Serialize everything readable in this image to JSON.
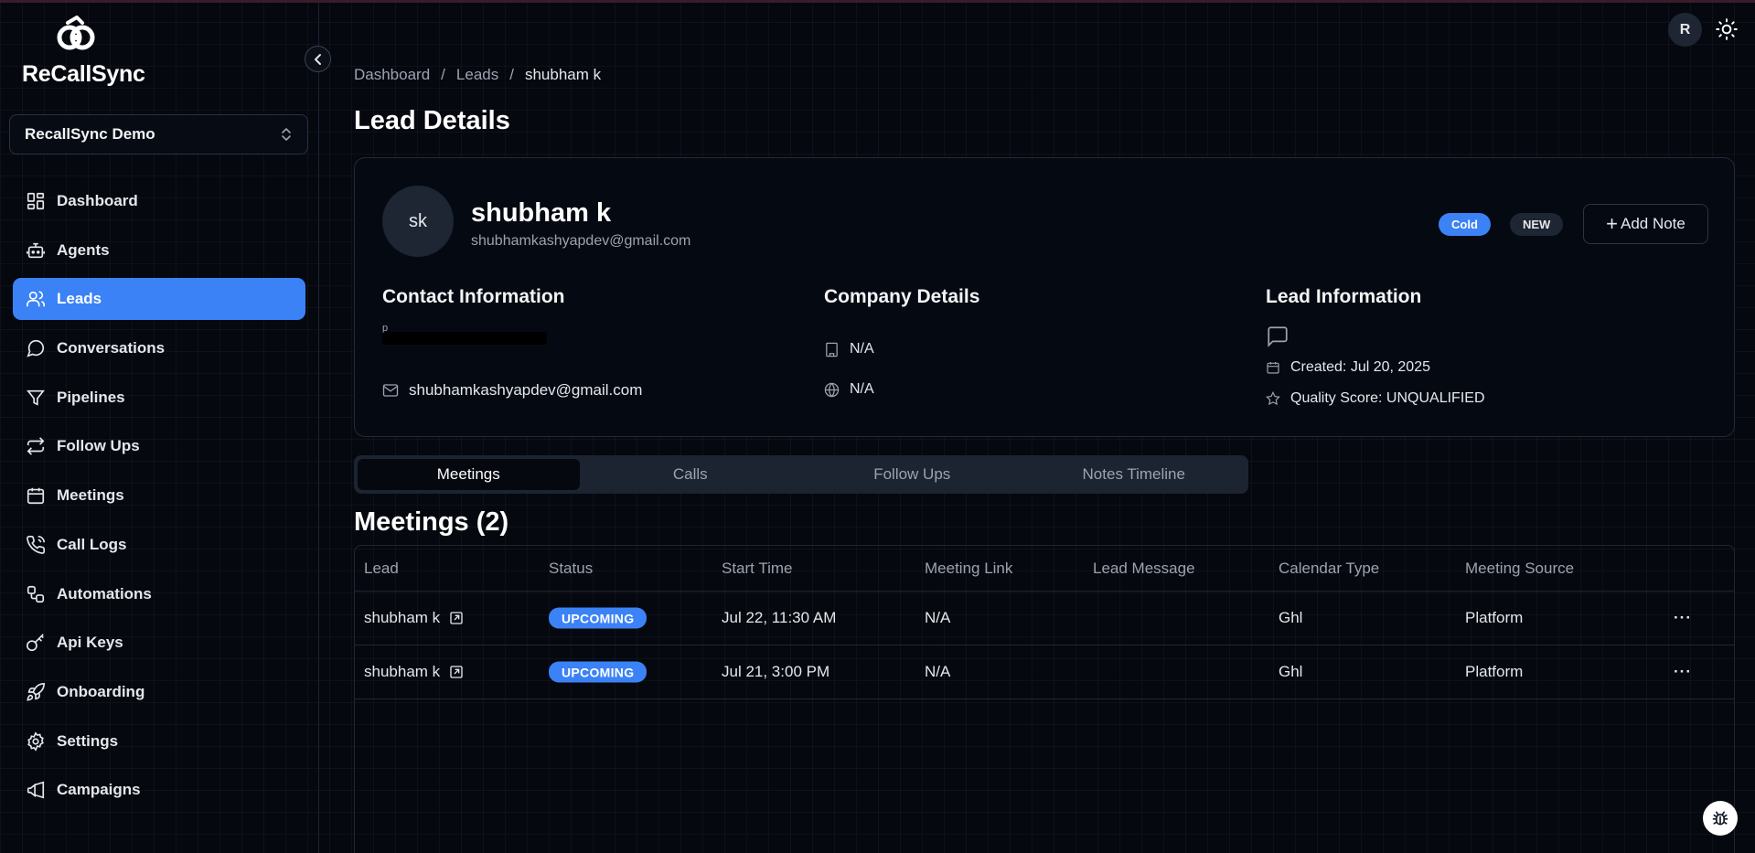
{
  "app": {
    "name": "ReCallSync"
  },
  "workspace": {
    "label": "RecallSync Demo"
  },
  "sidebar": {
    "items": [
      {
        "label": "Dashboard",
        "icon": "dashboard-icon"
      },
      {
        "label": "Agents",
        "icon": "bot-icon"
      },
      {
        "label": "Leads",
        "icon": "users-icon",
        "active": true
      },
      {
        "label": "Conversations",
        "icon": "message-circle-icon"
      },
      {
        "label": "Pipelines",
        "icon": "filter-icon"
      },
      {
        "label": "Follow Ups",
        "icon": "repeat-icon"
      },
      {
        "label": "Meetings",
        "icon": "calendar-icon"
      },
      {
        "label": "Call Logs",
        "icon": "phone-call-icon"
      },
      {
        "label": "Automations",
        "icon": "workflow-icon"
      },
      {
        "label": "Api Keys",
        "icon": "key-icon"
      },
      {
        "label": "Onboarding",
        "icon": "rocket-icon"
      },
      {
        "label": "Settings",
        "icon": "settings-icon"
      },
      {
        "label": "Campaigns",
        "icon": "megaphone-icon"
      }
    ]
  },
  "header": {
    "user_initial": "R"
  },
  "breadcrumb": {
    "items": [
      "Dashboard",
      "Leads",
      "shubham k"
    ]
  },
  "page": {
    "title": "Lead Details"
  },
  "lead": {
    "initials": "sk",
    "name": "shubham k",
    "email": "shubhamkashyapdev@gmail.com",
    "badges": {
      "temperature": "Cold",
      "stage": "NEW"
    },
    "add_note_label": "Add Note",
    "contact": {
      "title": "Contact Information",
      "phone_partial": "p",
      "email": "shubhamkashyapdev@gmail.com"
    },
    "company": {
      "title": "Company Details",
      "name": "N/A",
      "website": "N/A"
    },
    "info": {
      "title": "Lead Information",
      "created": "Created: Jul 20, 2025",
      "quality": "Quality Score: UNQUALIFIED"
    }
  },
  "tabs": [
    "Meetings",
    "Calls",
    "Follow Ups",
    "Notes Timeline"
  ],
  "meetings": {
    "title": "Meetings (2)",
    "columns": [
      "Lead",
      "Status",
      "Start Time",
      "Meeting Link",
      "Lead Message",
      "Calendar Type",
      "Meeting Source"
    ],
    "rows": [
      {
        "lead": "shubham k",
        "status": "UPCOMING",
        "start": "Jul 22, 11:30 AM",
        "link": "N/A",
        "message": "",
        "calendar": "Ghl",
        "source": "Platform"
      },
      {
        "lead": "shubham k",
        "status": "UPCOMING",
        "start": "Jul 21, 3:00 PM",
        "link": "N/A",
        "message": "",
        "calendar": "Ghl",
        "source": "Platform"
      }
    ]
  },
  "colors": {
    "accent": "#3b82f6",
    "background": "#05080f",
    "card": "#050912"
  }
}
